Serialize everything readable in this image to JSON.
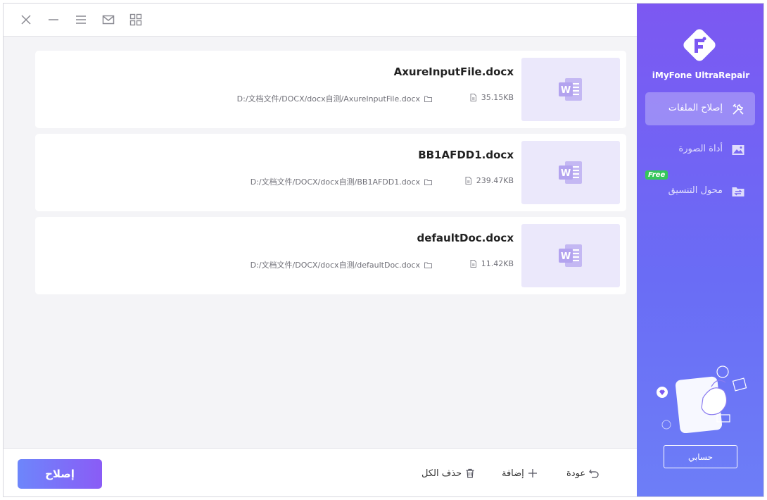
{
  "app": {
    "brand_name": "iMyFone UltraRepair",
    "accent_color": "#7c58f2",
    "sidebar_gradient": [
      "#7c58f2",
      "#6d7ef7"
    ]
  },
  "topbar": {
    "icons": [
      "close-icon",
      "minimize-icon",
      "menu-icon",
      "mail-icon",
      "grid-icon"
    ]
  },
  "sidebar": {
    "items": [
      {
        "label": "إصلاح الملفات",
        "icon": "repair-tools-icon",
        "active": true
      },
      {
        "label": "أداة الصورة",
        "icon": "image-icon",
        "active": false
      },
      {
        "label": "محول التنسيق",
        "icon": "folder-convert-icon",
        "active": false,
        "badge": "Free"
      }
    ],
    "account_label": "حسابي"
  },
  "files": [
    {
      "name": "AxureInputFile.docx",
      "path": "D:/文档文件/DOCX/docx自测/AxureInputFile.docx",
      "size": "35.15KB",
      "icon": "word-doc-icon"
    },
    {
      "name": "BB1AFDD1.docx",
      "path": "D:/文档文件/DOCX/docx自测/BB1AFDD1.docx",
      "size": "239.47KB",
      "icon": "word-doc-icon"
    },
    {
      "name": "defaultDoc.docx",
      "path": "D:/文档文件/DOCX/docx自测/defaultDoc.docx",
      "size": "11.42KB",
      "icon": "word-doc-icon"
    }
  ],
  "bottombar": {
    "repair_label": "إصلاح",
    "delete_all_label": "حذف الكل",
    "add_label": "إضافة",
    "back_label": "عودة"
  }
}
